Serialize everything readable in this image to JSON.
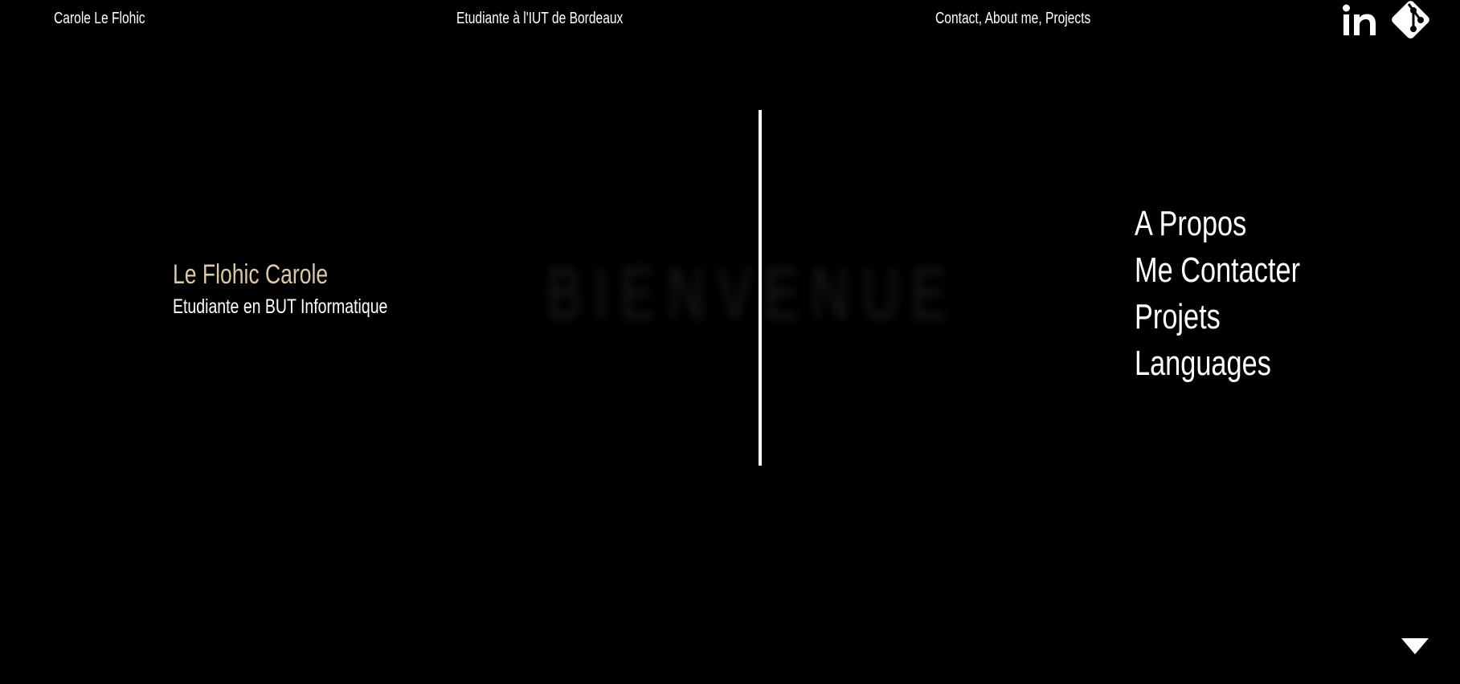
{
  "header": {
    "name": "Carole Le Flohic",
    "school": "Etudiante à l'IUT de Bordeaux",
    "links": "Contact, About me, Projects"
  },
  "social": {
    "linkedin_icon": "linkedin-icon",
    "linkedin_label": "in",
    "git_icon": "git-icon"
  },
  "intro": {
    "title": "Le Flohic Carole",
    "subtitle": "Etudiante en BUT Informatique"
  },
  "hero": {
    "welcome": "BIENVENUE"
  },
  "nav": {
    "items": [
      {
        "label": "A Propos"
      },
      {
        "label": "Me Contacter"
      },
      {
        "label": "Projets"
      },
      {
        "label": "Languages"
      }
    ]
  },
  "scroll": {
    "icon": "chevron-down-icon"
  },
  "colors": {
    "background": "#000000",
    "text": "#ffffff",
    "accent": "#dbc9a1"
  }
}
